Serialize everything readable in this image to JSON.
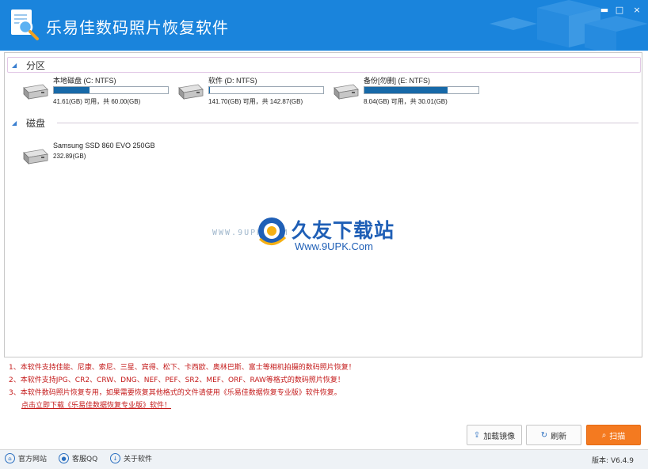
{
  "window": {
    "title": "乐易佳数码照片恢复软件",
    "controls": {
      "minimize": "▬",
      "maximize": "□",
      "close": "×"
    }
  },
  "sections": {
    "partitions_label": "分区",
    "disks_label": "磁盘"
  },
  "partitions": [
    {
      "name": "本地磁盘 (C: NTFS)",
      "usage": "41.61(GB) 可用，共 60.00(GB)",
      "used_fraction": 0.31
    },
    {
      "name": "软件 (D: NTFS)",
      "usage": "141.70(GB) 可用，共 142.87(GB)",
      "used_fraction": 0.01
    },
    {
      "name": "备份[勿删] (E: NTFS)",
      "usage": "8.04(GB) 可用，共 30.01(GB)",
      "used_fraction": 0.73
    }
  ],
  "disks": [
    {
      "name": "Samsung SSD 860 EVO 250GB",
      "size": "232.89(GB)"
    }
  ],
  "watermark": {
    "site_left": "WWW.9UPK.COM",
    "title": "久友下载站",
    "url": "Www.9UPK.Com"
  },
  "notes": [
    "1、本软件支持佳能、尼康、索尼、三星、宾得、松下、卡西欧、奥林巴斯、富士等相机拍摄的数码照片恢复！",
    "2、本软件支持JPG、CR2、CRW、DNG、NEF、PEF、SR2、MEF、ORF、RAW等格式的数码照片恢复！",
    "3、本软件数码照片恢复专用，如果需要恢复其他格式的文件请使用《乐易佳数据恢复专业版》软件恢复。"
  ],
  "download_link": "点击立即下载《乐易佳数据恢复专业版》软件！",
  "buttons": {
    "load_image": "加载镜像",
    "refresh": "刷新",
    "scan": "扫描"
  },
  "footer": {
    "official_site": "官方网站",
    "support_qq": "客服QQ",
    "about": "关于软件",
    "version": "版本: V6.4.9"
  },
  "colors": {
    "titlebar": "#1a84dc",
    "progress": "#1769a8",
    "scan_button": "#f47a20",
    "notes": "#c41a1a"
  }
}
